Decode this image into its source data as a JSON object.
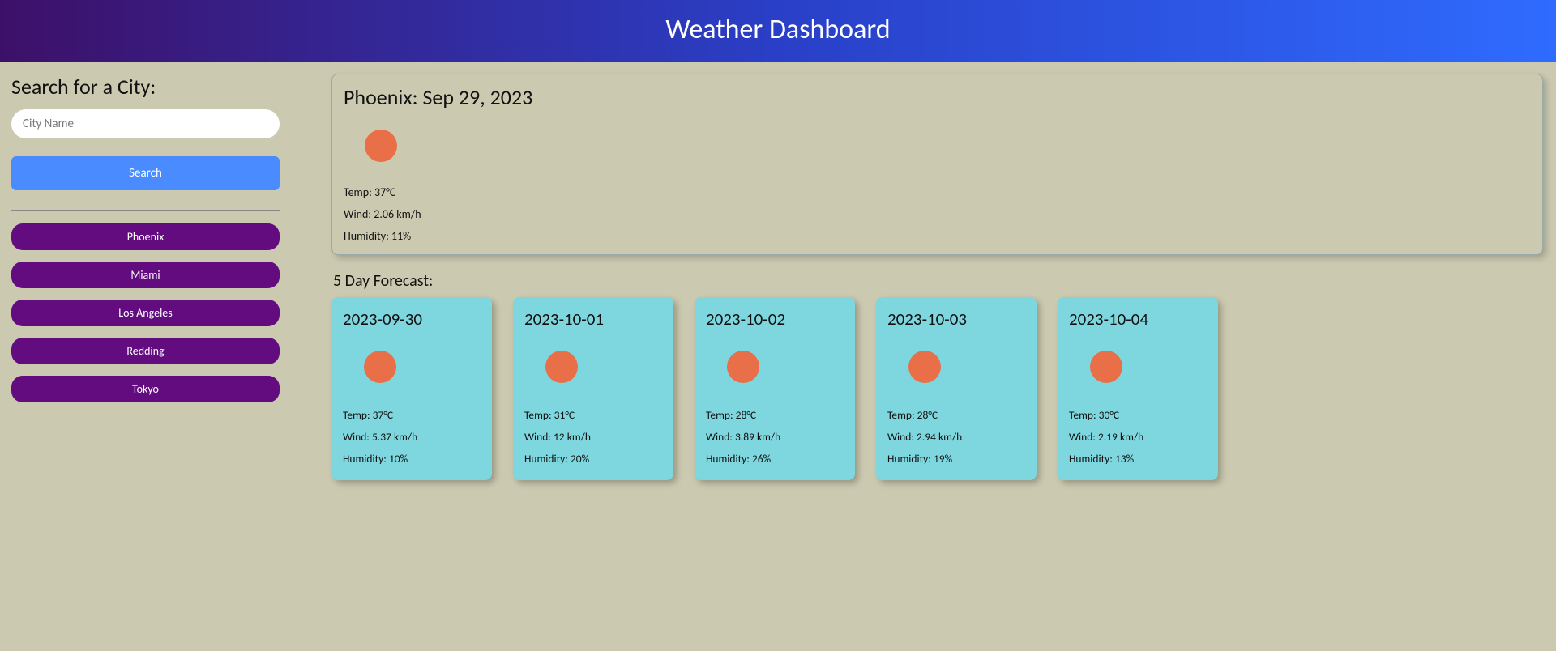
{
  "header": {
    "title": "Weather Dashboard"
  },
  "sidebar": {
    "searchHeading": "Search for a City:",
    "searchPlaceholder": "City Name",
    "searchButtonLabel": "Search",
    "history": [
      "Phoenix",
      "Miami",
      "Los Angeles",
      "Redding",
      "Tokyo"
    ]
  },
  "current": {
    "heading": "Phoenix: Sep 29, 2023",
    "temp": "Temp: 37°C",
    "wind": "Wind: 2.06 km/h",
    "humidity": "Humidity: 11%"
  },
  "forecastTitle": "5 Day Forecast:",
  "forecast": [
    {
      "date": "2023-09-30",
      "temp": "Temp: 37°C",
      "wind": "Wind: 5.37 km/h",
      "humidity": "Humidity: 10%"
    },
    {
      "date": "2023-10-01",
      "temp": "Temp: 31°C",
      "wind": "Wind: 12 km/h",
      "humidity": "Humidity: 20%"
    },
    {
      "date": "2023-10-02",
      "temp": "Temp: 28°C",
      "wind": "Wind: 3.89 km/h",
      "humidity": "Humidity: 26%"
    },
    {
      "date": "2023-10-03",
      "temp": "Temp: 28°C",
      "wind": "Wind: 2.94 km/h",
      "humidity": "Humidity: 19%"
    },
    {
      "date": "2023-10-04",
      "temp": "Temp: 30°C",
      "wind": "Wind: 2.19 km/h",
      "humidity": "Humidity: 13%"
    }
  ]
}
